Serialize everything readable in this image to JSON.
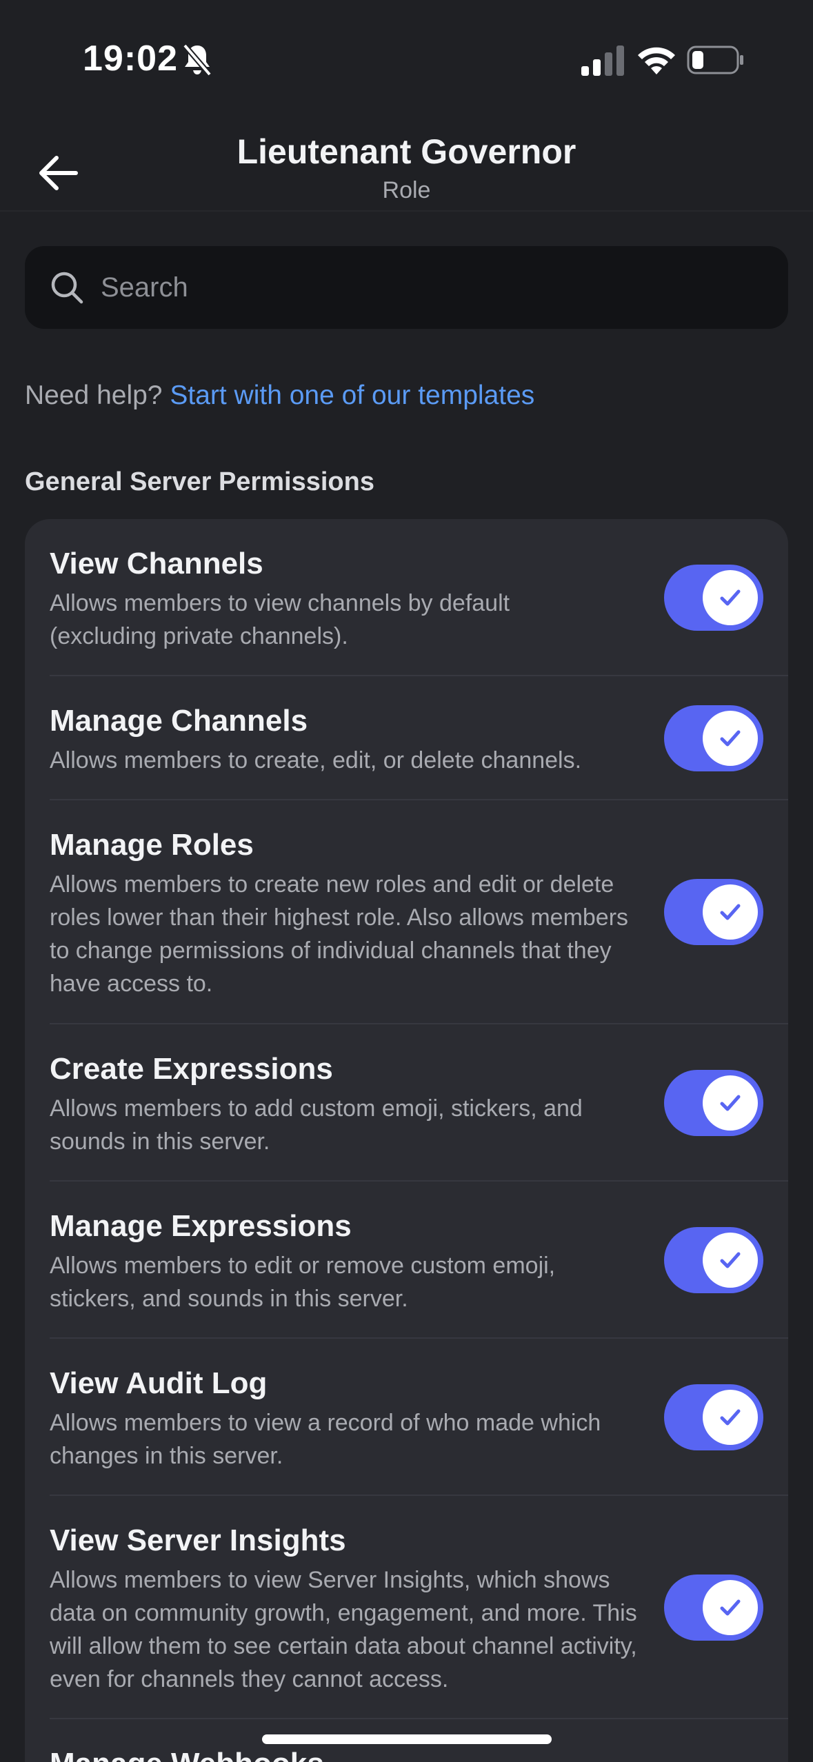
{
  "status_bar": {
    "time": "19:02",
    "icons": [
      "bell-slash-icon",
      "signal-icon",
      "wifi-icon",
      "battery-icon"
    ]
  },
  "header": {
    "title": "Lieutenant Governor",
    "subtitle": "Role",
    "back_icon": "arrow-left-icon"
  },
  "search": {
    "placeholder": "Search",
    "value": ""
  },
  "help": {
    "prefix": "Need help?",
    "link": "Start with one of our templates"
  },
  "section": {
    "title": "General Server Permissions"
  },
  "permissions": [
    {
      "title": "View Channels",
      "description": "Allows members to view channels by default (excluding private channels).",
      "enabled": true
    },
    {
      "title": "Manage Channels",
      "description": "Allows members to create, edit, or delete channels.",
      "enabled": true
    },
    {
      "title": "Manage Roles",
      "description": "Allows members to create new roles and edit or delete roles lower than their highest role. Also allows members to change permissions of individual channels that they have access to.",
      "enabled": true
    },
    {
      "title": "Create Expressions",
      "description": "Allows members to add custom emoji, stickers, and sounds in this server.",
      "enabled": true
    },
    {
      "title": "Manage Expressions",
      "description": "Allows members to edit or remove custom emoji, stickers, and sounds in this server.",
      "enabled": true
    },
    {
      "title": "View Audit Log",
      "description": "Allows members to view a record of who made which changes in this server.",
      "enabled": true
    },
    {
      "title": "View Server Insights",
      "description": "Allows members to view Server Insights, which shows data on community growth, engagement, and more. This will allow them to see certain data about channel activity, even for channels they cannot access.",
      "enabled": true
    },
    {
      "title": "Manage Webhooks",
      "description": "",
      "enabled": true
    }
  ],
  "colors": {
    "background": "#1f2024",
    "card": "#2b2c32",
    "accent": "#5865f2",
    "link": "#5b9bf5"
  }
}
